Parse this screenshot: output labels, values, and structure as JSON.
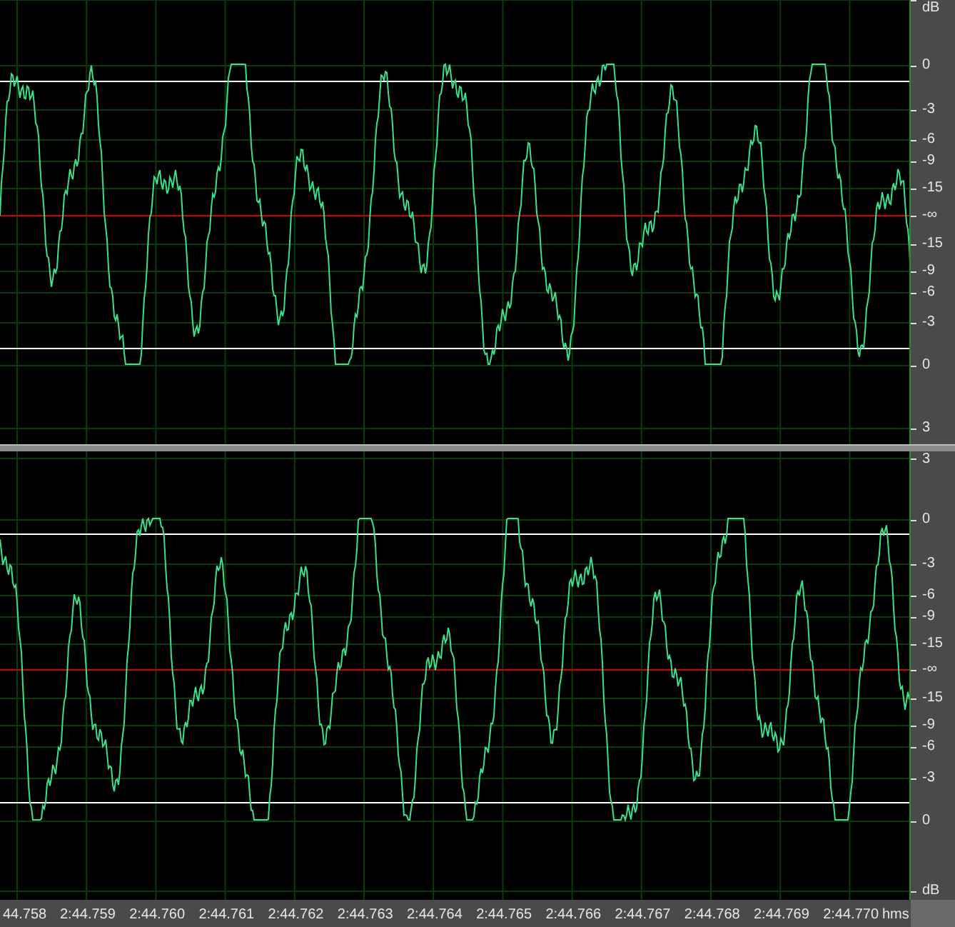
{
  "channels": [
    {
      "ruler_labels": [
        "dB",
        "0",
        "-3",
        "-6",
        "-9",
        "-15",
        "-∞",
        "-15",
        "-9",
        "-6",
        "-3",
        "0",
        "3"
      ]
    },
    {
      "ruler_labels": [
        "3",
        "0",
        "-3",
        "-6",
        "-9",
        "-15",
        "-∞",
        "-15",
        "-9",
        "-6",
        "-3",
        "0",
        "dB"
      ]
    }
  ],
  "time_ruler": {
    "labels": [
      "44.758",
      "2:44.759",
      "2:44.760",
      "2:44.761",
      "2:44.762",
      "2:44.763",
      "2:44.764",
      "2:44.765",
      "2:44.766",
      "2:44.767",
      "2:44.768",
      "2:44.769",
      "2:44.770"
    ],
    "unit": "hms"
  }
}
